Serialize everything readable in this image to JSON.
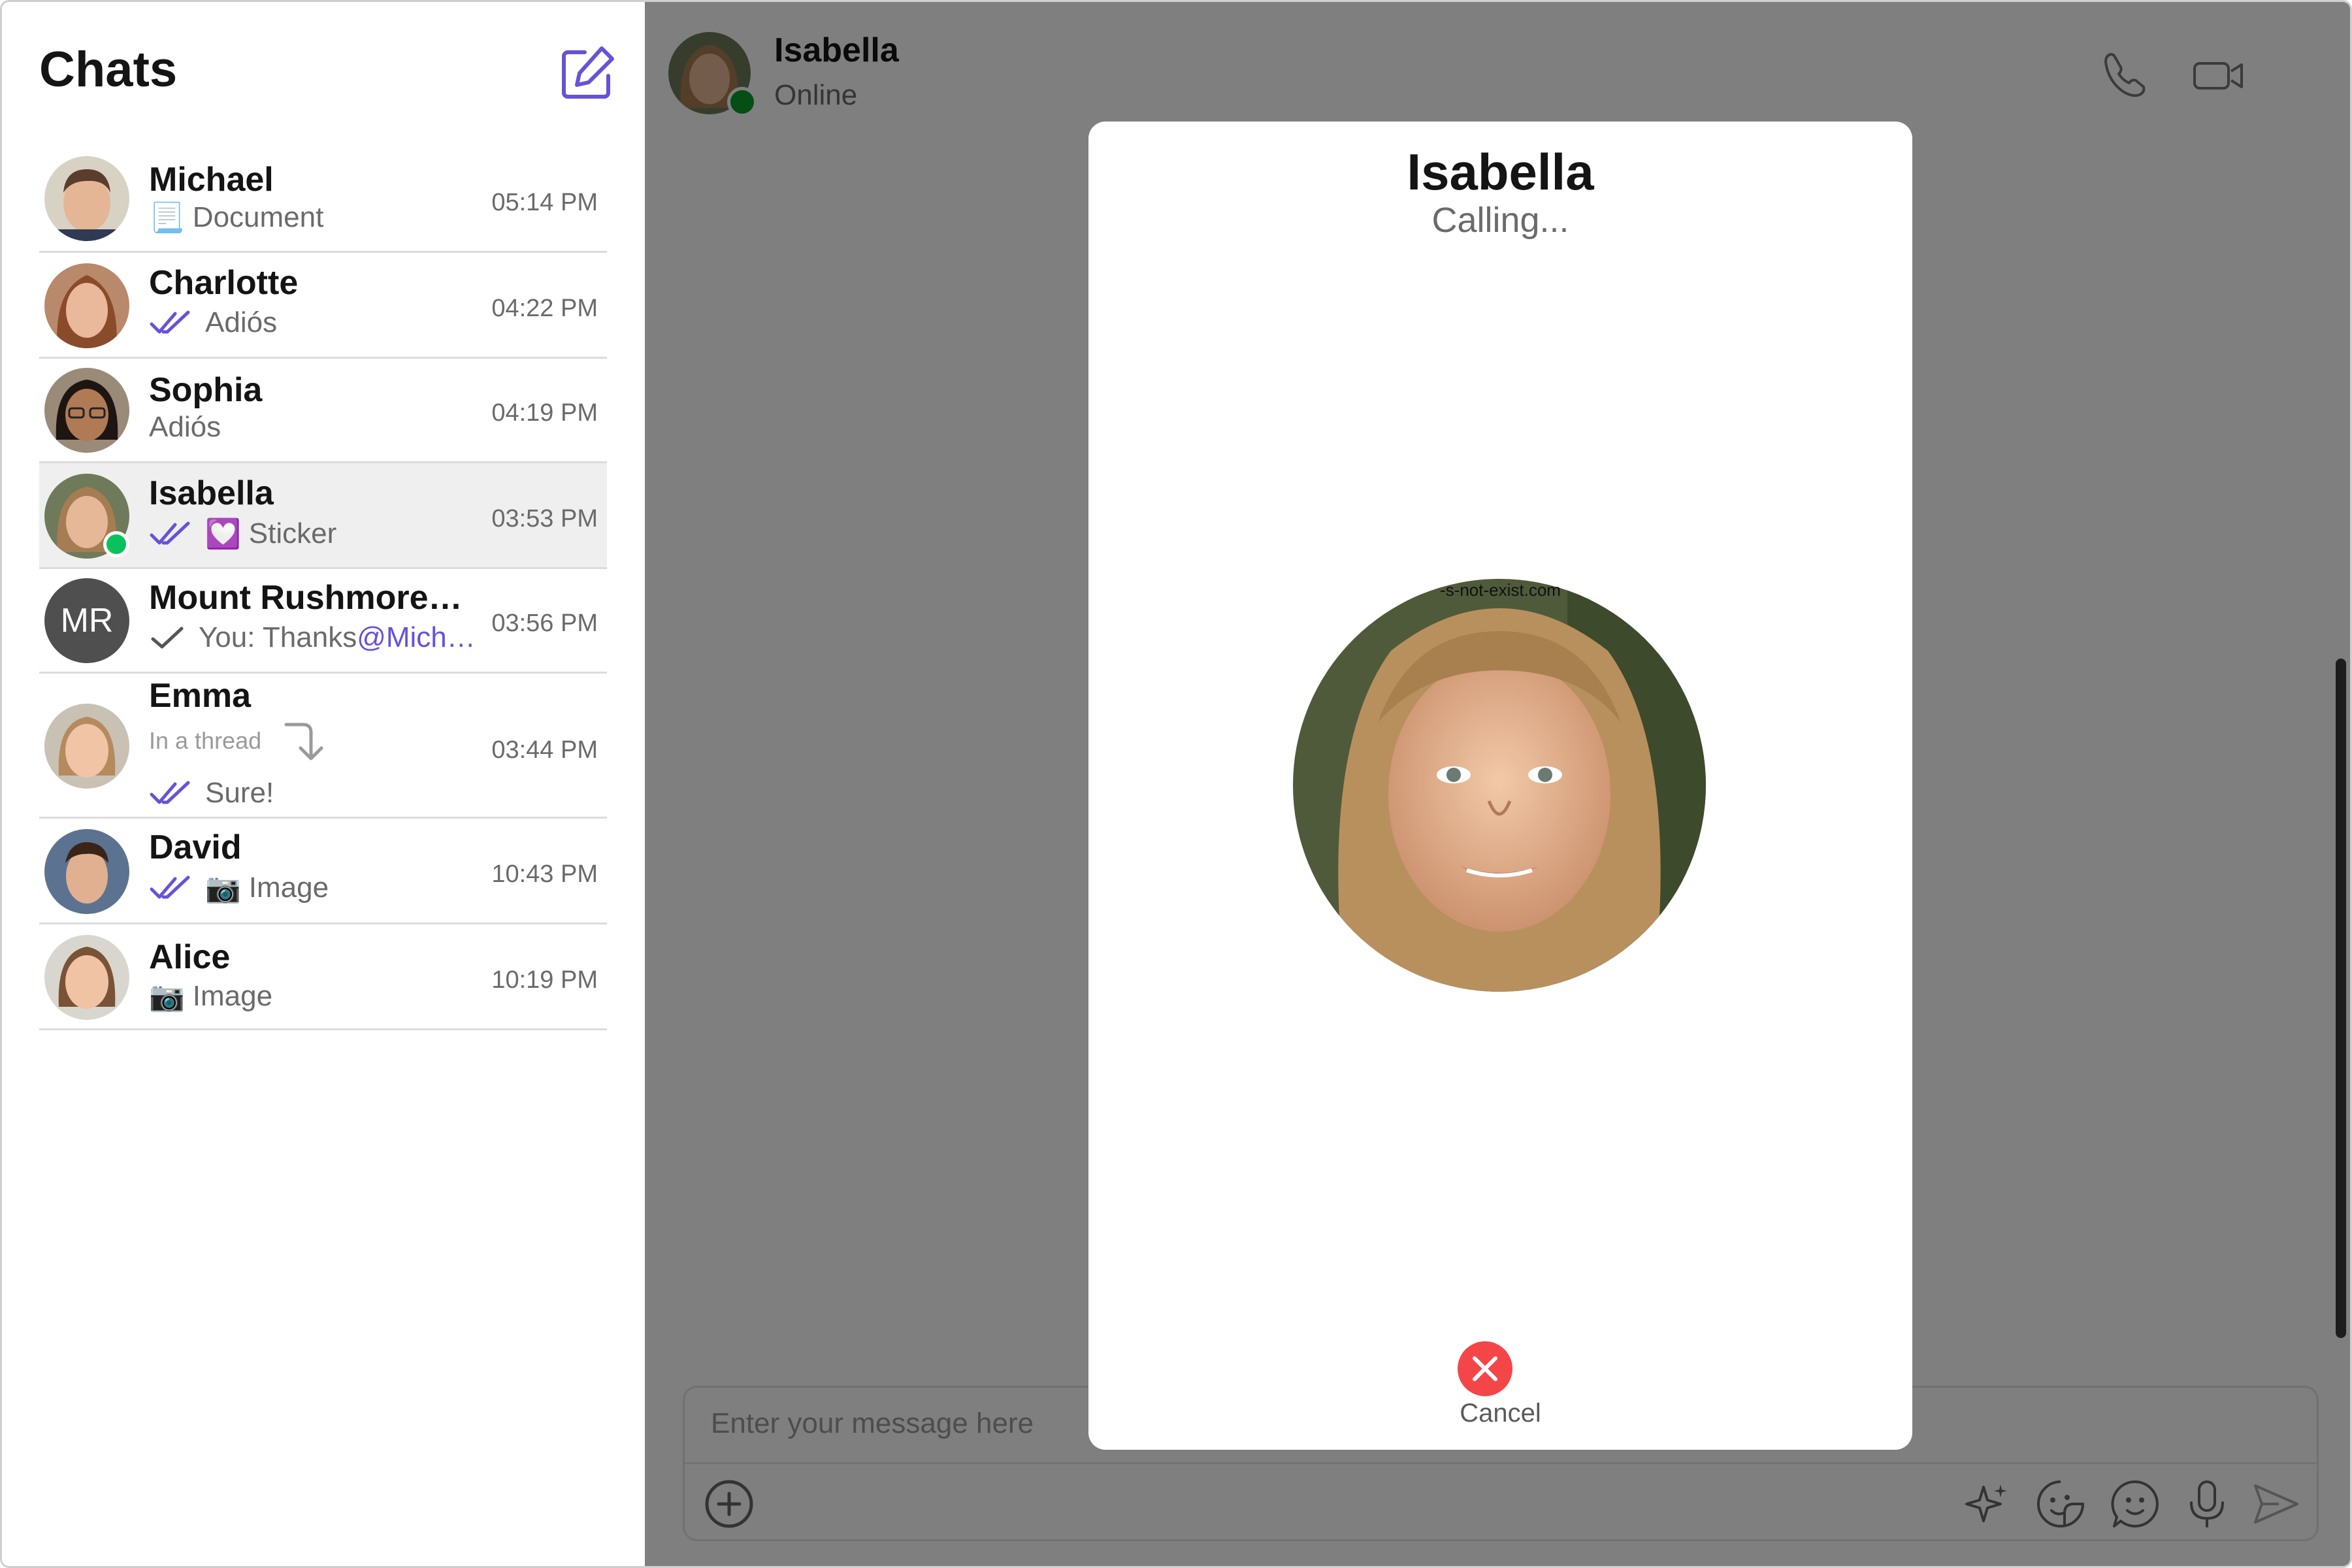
{
  "sidebar": {
    "title": "Chats",
    "compose_icon": "compose-icon",
    "conversations": [
      {
        "name": "Michael",
        "time": "05:14 PM",
        "preview_icon": "📃",
        "preview": "Document",
        "receipt": "none"
      },
      {
        "name": "Charlotte",
        "time": "04:22 PM",
        "preview": "Adiós",
        "receipt": "read"
      },
      {
        "name": "Sophia",
        "time": "04:19 PM",
        "preview": "Adiós",
        "receipt": "none"
      },
      {
        "name": "Isabella",
        "time": "03:53 PM",
        "preview_icon": "💟",
        "preview": "Sticker",
        "receipt": "read",
        "online": true,
        "selected": true
      },
      {
        "name": "Mount Rushmore…",
        "initials": "MR",
        "time": "03:56 PM",
        "preview": "You: Thanks ",
        "mention": "@Mich…",
        "receipt": "sent"
      },
      {
        "name": "Emma",
        "time": "03:44 PM",
        "thread_label": "In a thread",
        "preview": "Sure!",
        "receipt": "read"
      },
      {
        "name": "David",
        "time": "10:43 PM",
        "preview_icon": "📷",
        "preview": "Image",
        "receipt": "read"
      },
      {
        "name": "Alice",
        "time": "10:19 PM",
        "preview_icon": "📷",
        "preview": "Image",
        "receipt": "none"
      }
    ]
  },
  "chat_header": {
    "name": "Isabella",
    "status": "Online",
    "icons": [
      "phone-icon",
      "video-icon"
    ]
  },
  "composer": {
    "placeholder": "Enter your message here",
    "icons": [
      "add-icon",
      "ai-sparkle-icon",
      "sticker-icon",
      "emoji-icon",
      "microphone-icon",
      "send-icon"
    ]
  },
  "call_modal": {
    "name": "Isabella",
    "status": "Calling...",
    "watermark": "-s-not-exist.com",
    "cancel_label": "Cancel"
  },
  "colors": {
    "accent": "#6852d6",
    "online": "#09c25c",
    "cancel": "#f44649",
    "overlay": "rgba(0,0,0,0.5)"
  }
}
